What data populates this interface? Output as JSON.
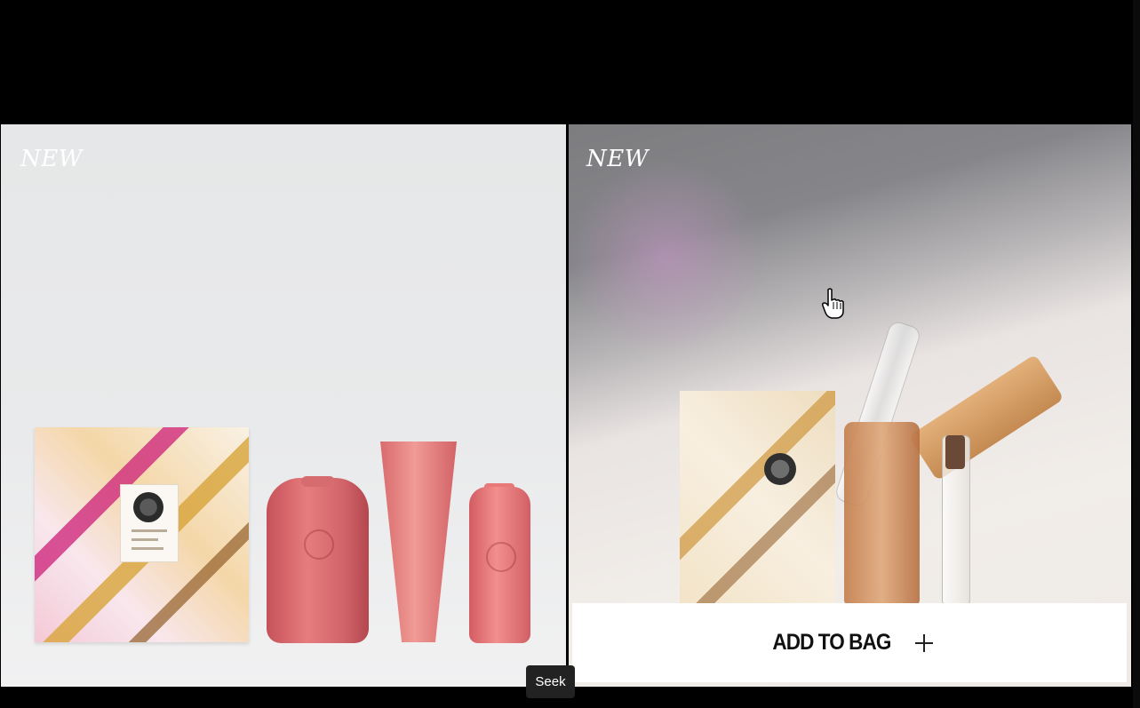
{
  "cards": [
    {
      "badge": "NEW"
    },
    {
      "badge": "NEW"
    }
  ],
  "add_to_bag": {
    "label": "ADD TO BAG"
  },
  "tooltip": {
    "text": "Seek"
  },
  "icons": {
    "plus": "plus-icon",
    "cursor": "hand-cursor-icon"
  },
  "colors": {
    "background": "#000000",
    "button_bg": "#ffffff",
    "button_text": "#111111",
    "tooltip_bg": "#222222"
  }
}
